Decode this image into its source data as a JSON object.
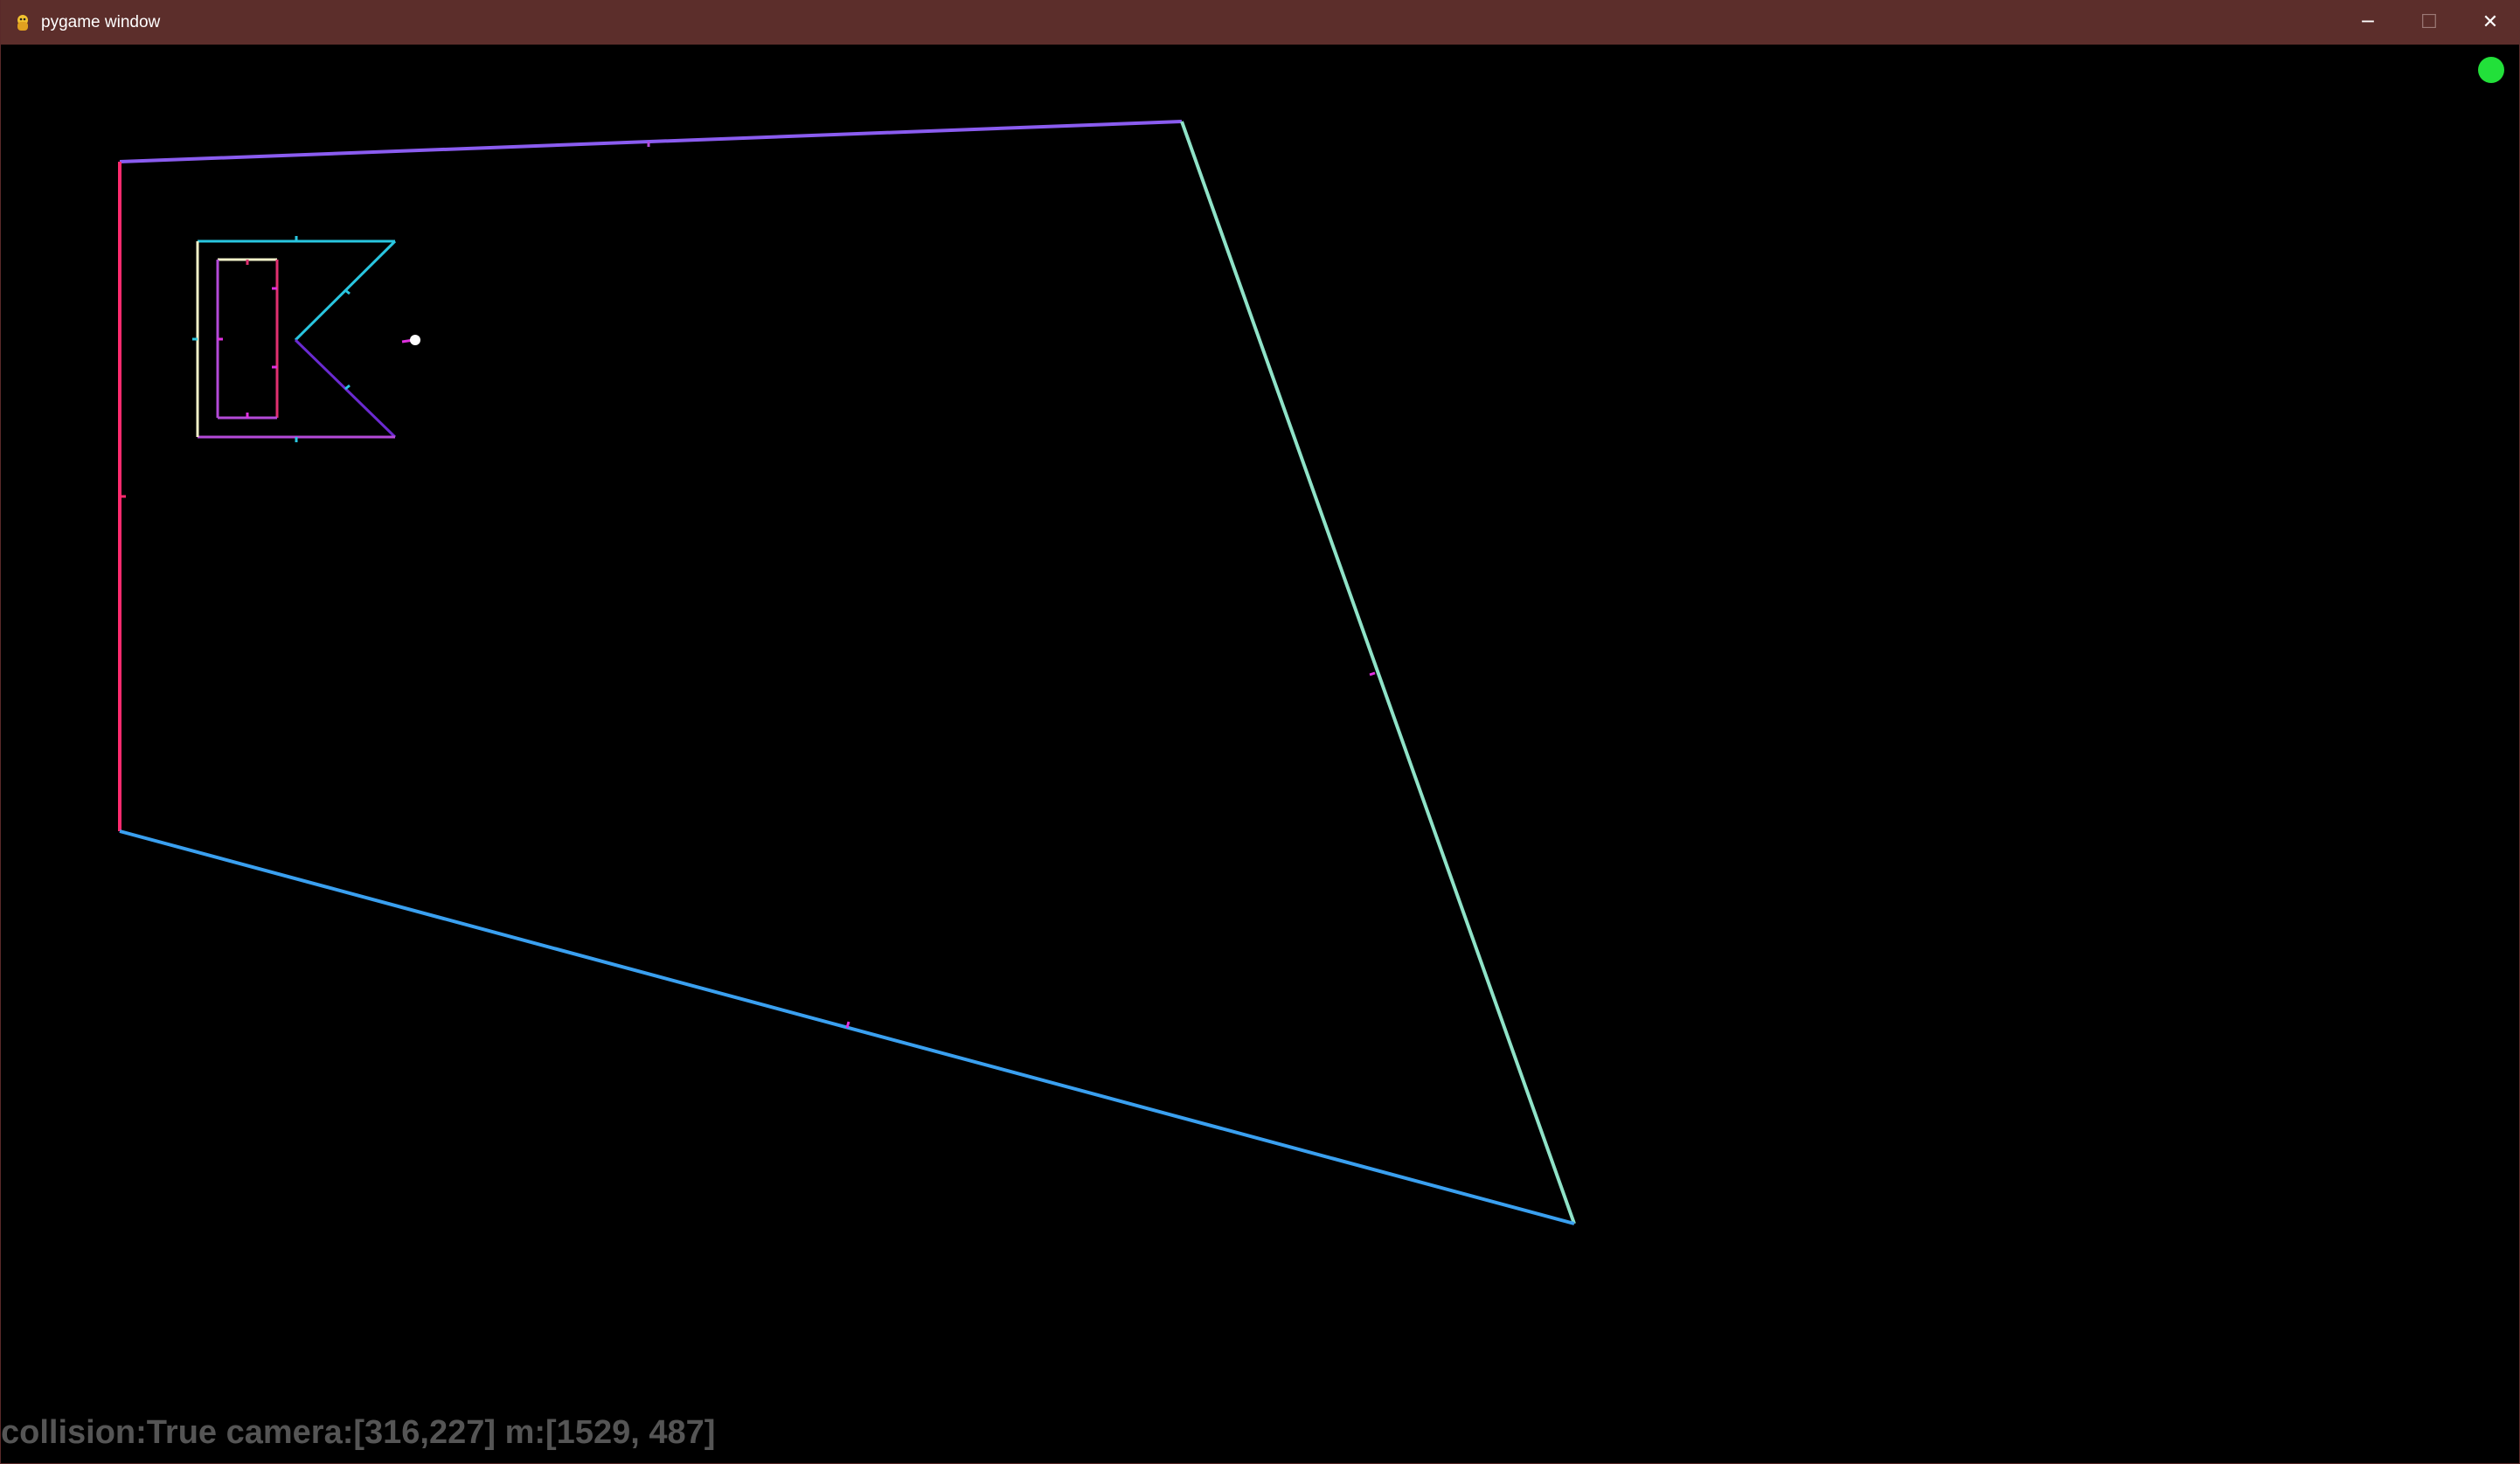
{
  "window": {
    "title": "pygame window",
    "minimize_label": "─",
    "maximize_label": "☐",
    "close_label": "✕"
  },
  "hud": {
    "status_text": "collision:True camera:[316,227] m:[1529, 487]",
    "status_dot_color": "#22e03a"
  },
  "scene": {
    "outer_walls_color_top": "#8a5cf0",
    "outer_walls_color_left": "#ff2a6e",
    "outer_walls_color_right": "#8fe3c8",
    "outer_walls_color_bottom": "#3aa0f0",
    "inner_shape_colors": [
      "#29c6e0",
      "#b44ad8",
      "#f0f0c8",
      "#e030e0"
    ],
    "player_color": "#ffffff"
  }
}
